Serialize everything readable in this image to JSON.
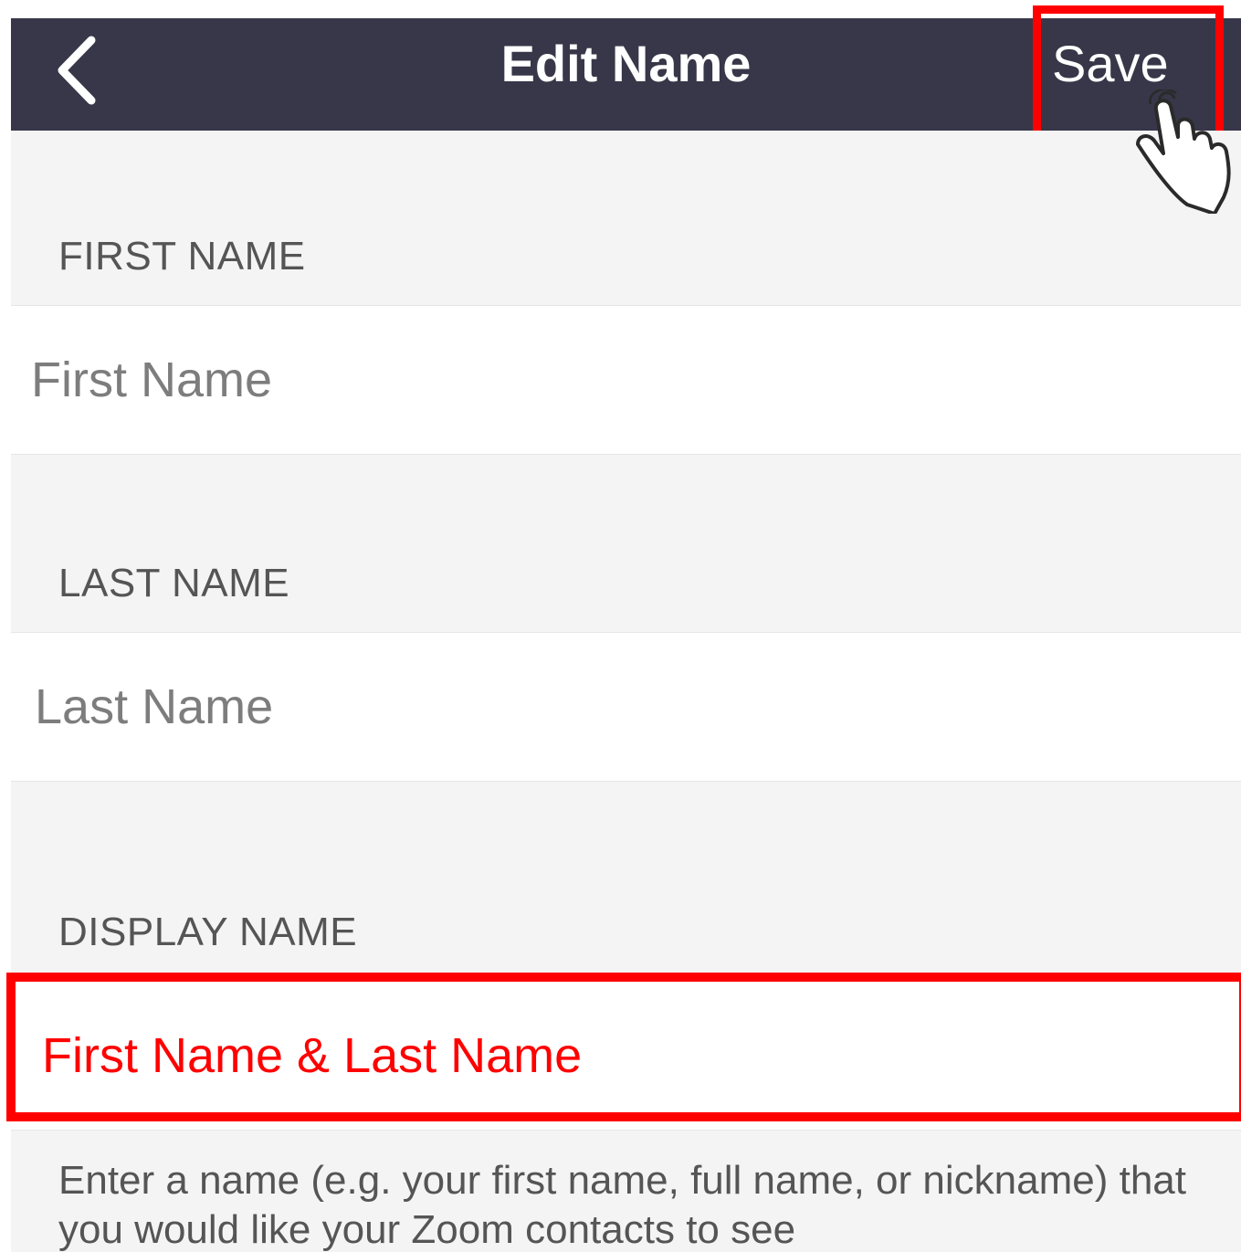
{
  "navbar": {
    "title": "Edit Name",
    "back_icon": "chevron-left-icon",
    "save_label": "Save",
    "background": "#383749"
  },
  "first_name": {
    "section_label": "FIRST NAME",
    "placeholder": "First Name"
  },
  "last_name": {
    "section_label": "LAST NAME",
    "placeholder": "Last Name"
  },
  "display_name": {
    "section_label": "DISPLAY NAME",
    "placeholder": "First Name & Last Name"
  },
  "help_text": "Enter a name (e.g. your first name, full name, or nickname) that you would like your Zoom contacts to see",
  "annotations": {
    "highlight_color": "#ff0000",
    "pointer_icon": "hand-pointer-icon"
  }
}
